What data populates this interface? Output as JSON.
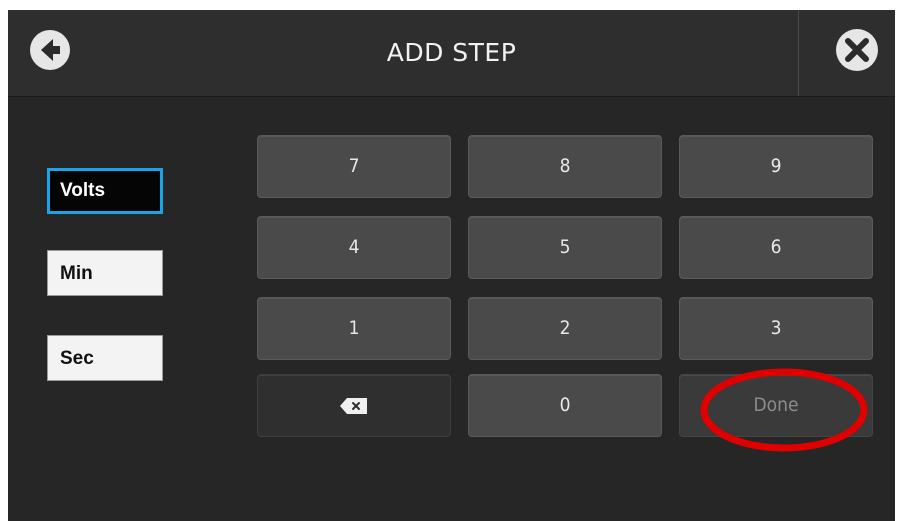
{
  "header": {
    "title": "ADD STEP",
    "back_icon": "arrow-left-circle-icon",
    "close_icon": "x-circle-icon"
  },
  "units": [
    {
      "label": "Volts",
      "selected": true
    },
    {
      "label": "Min",
      "selected": false
    },
    {
      "label": "Sec",
      "selected": false
    }
  ],
  "keypad": {
    "k7": "7",
    "k8": "8",
    "k9": "9",
    "k4": "4",
    "k5": "5",
    "k6": "6",
    "k1": "1",
    "k2": "2",
    "k3": "3",
    "backspace_icon": "backspace-icon",
    "k0": "0",
    "done": "Done"
  },
  "colors": {
    "selected_border": "#1aa6e6",
    "annotation": "#e00000"
  }
}
